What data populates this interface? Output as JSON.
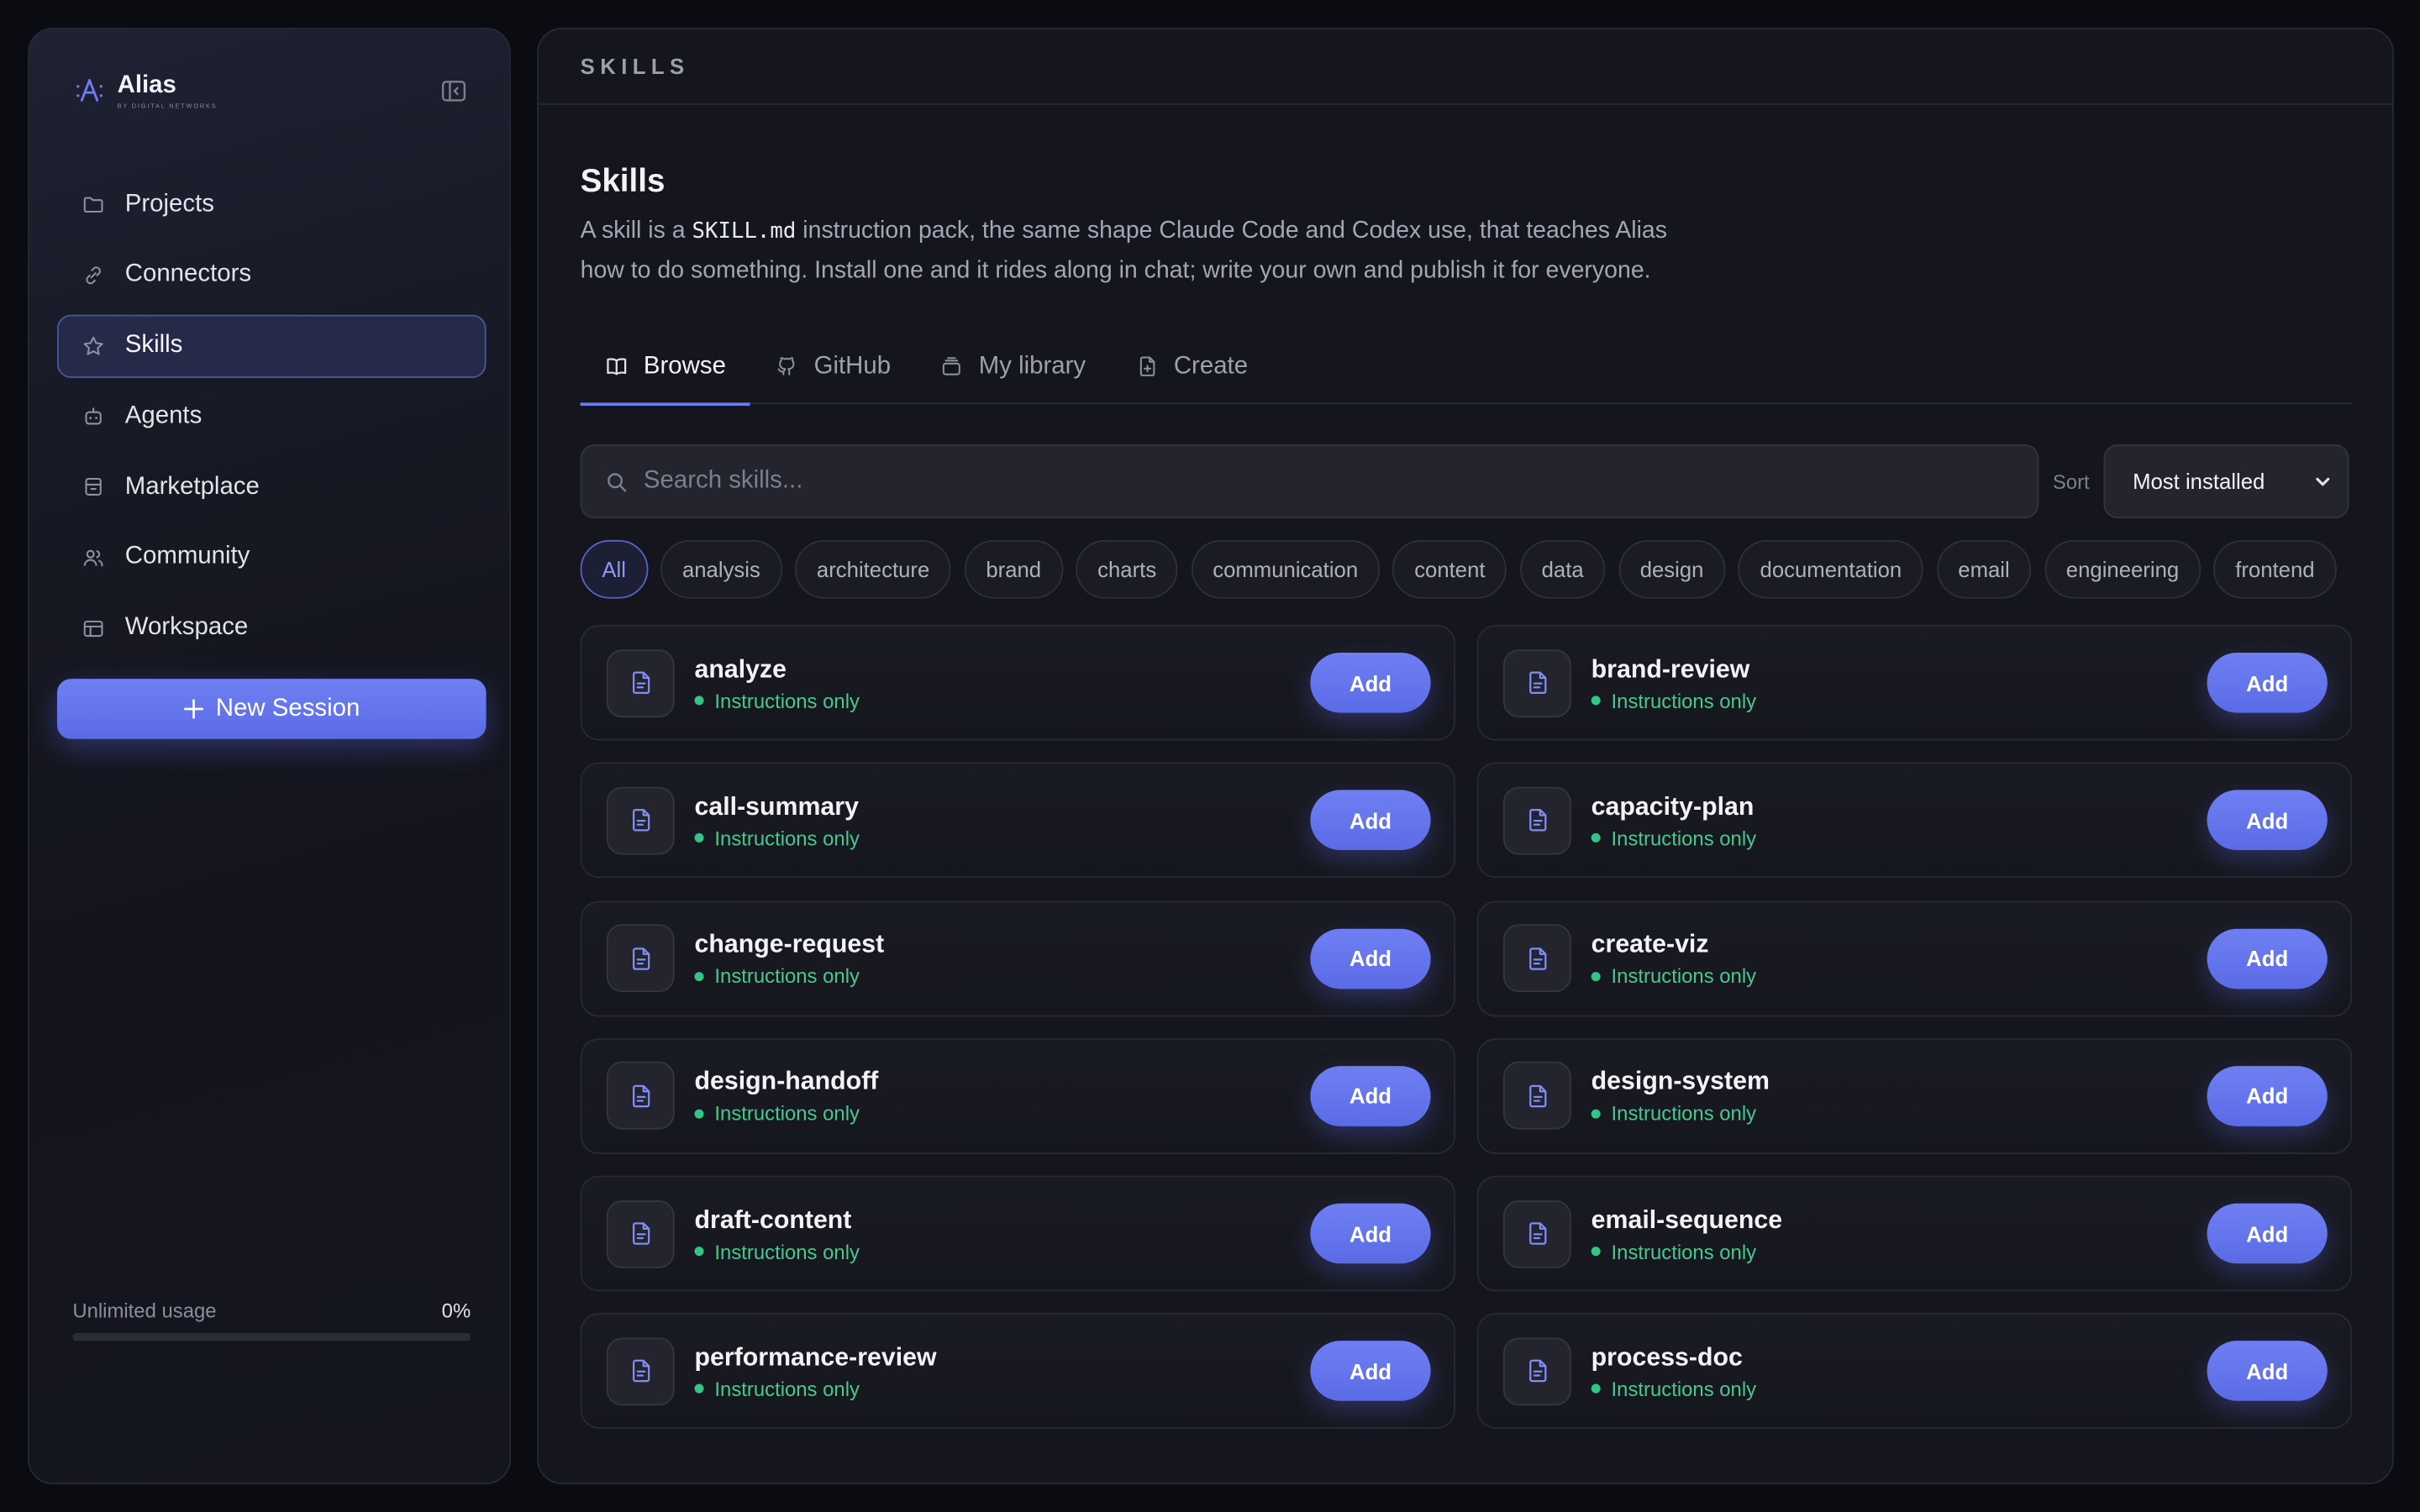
{
  "app": {
    "name": "Alias",
    "tagline": "BY DIGITAL NETWORKS"
  },
  "sidebar": {
    "items": [
      {
        "label": "Projects",
        "icon": "folder-icon"
      },
      {
        "label": "Connectors",
        "icon": "link-icon"
      },
      {
        "label": "Skills",
        "icon": "star-icon",
        "active": true
      },
      {
        "label": "Agents",
        "icon": "bot-icon"
      },
      {
        "label": "Marketplace",
        "icon": "store-icon"
      },
      {
        "label": "Community",
        "icon": "users-icon"
      },
      {
        "label": "Workspace",
        "icon": "layout-icon"
      }
    ],
    "new_session_label": "New Session",
    "usage": {
      "label": "Unlimited usage",
      "percent_text": "0%",
      "percent": 0
    }
  },
  "header": {
    "title": "SKILLS"
  },
  "main": {
    "title": "Skills",
    "description": {
      "before": "A skill is a ",
      "code": "SKILL.md",
      "after": " instruction pack, the same shape Claude Code and Codex use, that teaches Alias how to do something. Install one and it rides along in chat; write your own and publish it for everyone."
    },
    "tabs": [
      {
        "label": "Browse",
        "icon": "book-open-icon",
        "active": true
      },
      {
        "label": "GitHub",
        "icon": "github-icon"
      },
      {
        "label": "My library",
        "icon": "library-icon"
      },
      {
        "label": "Create",
        "icon": "file-plus-icon"
      }
    ],
    "search": {
      "placeholder": "Search skills...",
      "value": ""
    },
    "sort": {
      "label": "Sort",
      "selected": "Most installed"
    },
    "filters": [
      "All",
      "analysis",
      "architecture",
      "brand",
      "charts",
      "communication",
      "content",
      "data",
      "design",
      "documentation",
      "email",
      "engineering",
      "frontend"
    ],
    "active_filter": "All",
    "add_label": "Add",
    "skills": [
      {
        "name": "analyze",
        "status": "Instructions only"
      },
      {
        "name": "brand-review",
        "status": "Instructions only"
      },
      {
        "name": "call-summary",
        "status": "Instructions only"
      },
      {
        "name": "capacity-plan",
        "status": "Instructions only"
      },
      {
        "name": "change-request",
        "status": "Instructions only"
      },
      {
        "name": "create-viz",
        "status": "Instructions only"
      },
      {
        "name": "design-handoff",
        "status": "Instructions only"
      },
      {
        "name": "design-system",
        "status": "Instructions only"
      },
      {
        "name": "draft-content",
        "status": "Instructions only"
      },
      {
        "name": "email-sequence",
        "status": "Instructions only"
      },
      {
        "name": "performance-review",
        "status": "Instructions only"
      },
      {
        "name": "process-doc",
        "status": "Instructions only"
      }
    ]
  },
  "colors": {
    "accent": "#6a7cf0",
    "status_ok": "#34c487",
    "background": "#0b0c11",
    "panel": "#14151d"
  }
}
